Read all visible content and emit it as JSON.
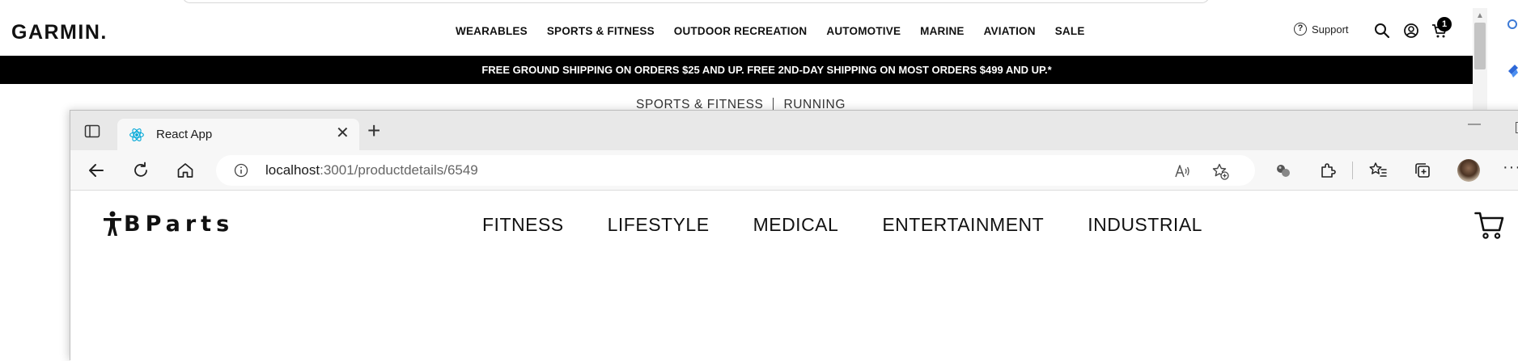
{
  "garmin": {
    "logo": "GARMIN.",
    "nav": [
      "WEARABLES",
      "SPORTS & FITNESS",
      "OUTDOOR RECREATION",
      "AUTOMOTIVE",
      "MARINE",
      "AVIATION",
      "SALE"
    ],
    "support": "Support",
    "cart_count": "1",
    "banner": "FREE GROUND SHIPPING ON ORDERS $25 AND UP. FREE 2ND-DAY SHIPPING ON MOST ORDERS $499 AND UP.*",
    "breadcrumb": [
      "SPORTS & FITNESS",
      "RUNNING"
    ]
  },
  "browser": {
    "tab_title": "React App",
    "url_host": "localhost",
    "url_path": ":3001/productdetails/6549"
  },
  "site": {
    "logo_text": "BParts",
    "nav": [
      "FITNESS",
      "LIFESTYLE",
      "MEDICAL",
      "ENTERTAINMENT",
      "INDUSTRIAL"
    ]
  },
  "icons": {
    "react_color": "#00a8d8"
  }
}
